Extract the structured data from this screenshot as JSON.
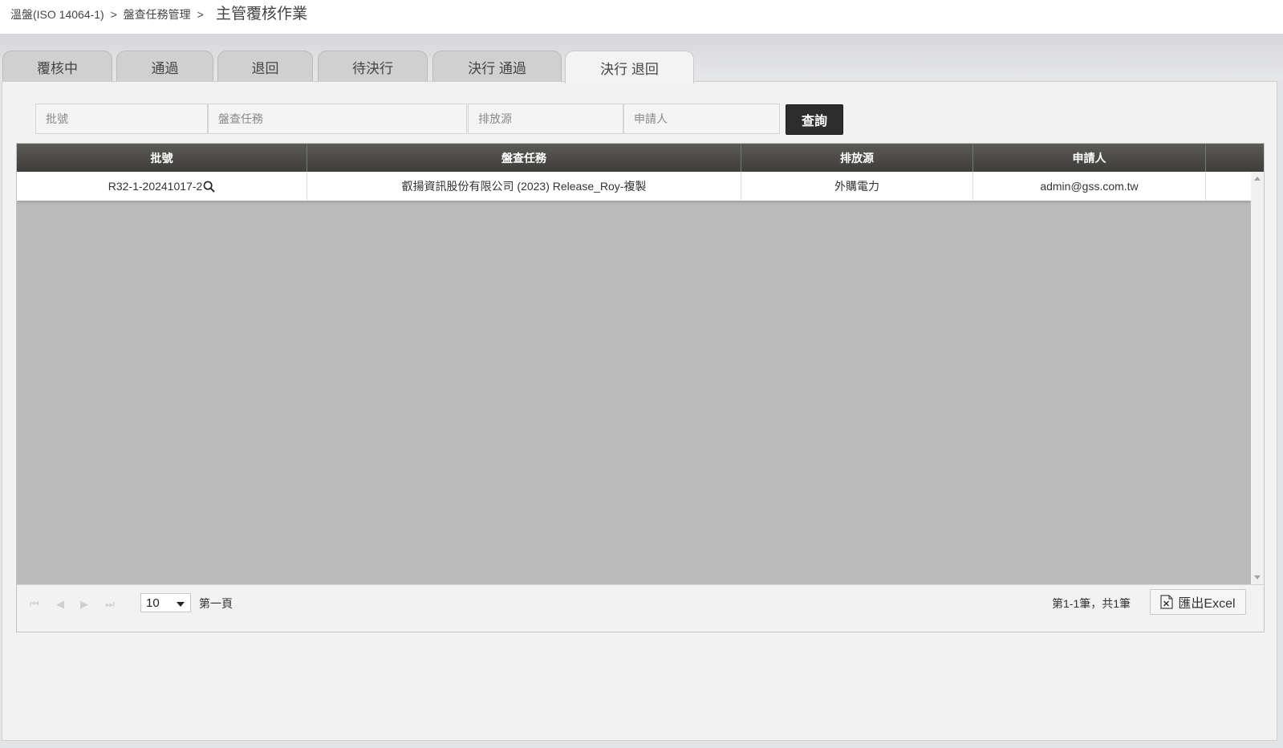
{
  "breadcrumb": {
    "items": [
      "溫盤(ISO 14064-1)",
      "盤查任務管理"
    ],
    "separator": ">"
  },
  "page_title": "主管覆核作業",
  "tabs": [
    {
      "label": "覆核中",
      "active": false
    },
    {
      "label": "通過",
      "active": false
    },
    {
      "label": "退回",
      "active": false
    },
    {
      "label": "待決行",
      "active": false
    },
    {
      "label": "決行 通過",
      "active": false
    },
    {
      "label": "決行 退回",
      "active": true
    }
  ],
  "filters": {
    "batch_placeholder": "批號",
    "task_placeholder": "盤查任務",
    "source_placeholder": "排放源",
    "applicant_placeholder": "申請人",
    "query_label": "查詢"
  },
  "grid": {
    "columns": [
      "批號",
      "盤查任務",
      "排放源",
      "申請人"
    ],
    "rows": [
      {
        "batch": "R32-1-20241017-2",
        "task": "叡揚資訊股份有限公司 (2023) Release_Roy-複製",
        "source": "外購電力",
        "applicant": "admin@gss.com.tw"
      }
    ]
  },
  "pager": {
    "page_size": "10",
    "page_label": "第一頁",
    "record_info": "第1-1筆，共1筆",
    "export_label": "匯出Excel"
  },
  "colors": {
    "header_dark": "#3e3d3a",
    "query_button": "#2d2d2d",
    "panel_bg": "#f2f2f2",
    "empty_grid": "#bababa"
  }
}
